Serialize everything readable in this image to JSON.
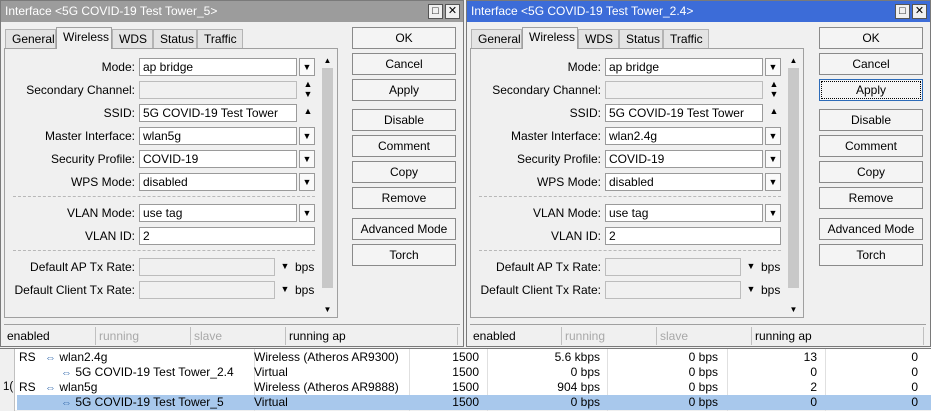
{
  "windows": [
    {
      "title": "Interface <5G COVID-19 Test Tower_5>",
      "tabs": [
        "General",
        "Wireless",
        "WDS",
        "Status",
        "Traffic"
      ],
      "active_tab": "Wireless",
      "fields": {
        "mode": {
          "label": "Mode:",
          "value": "ap bridge"
        },
        "secondary_channel": {
          "label": "Secondary Channel:",
          "value": ""
        },
        "ssid": {
          "label": "SSID:",
          "value": "5G COVID-19 Test Tower"
        },
        "master_interface": {
          "label": "Master Interface:",
          "value": "wlan5g"
        },
        "security_profile": {
          "label": "Security Profile:",
          "value": "COVID-19"
        },
        "wps_mode": {
          "label": "WPS Mode:",
          "value": "disabled"
        },
        "vlan_mode": {
          "label": "VLAN Mode:",
          "value": "use tag"
        },
        "vlan_id": {
          "label": "VLAN ID:",
          "value": "2"
        },
        "default_ap_tx_rate": {
          "label": "Default AP Tx Rate:",
          "value": "",
          "unit": "bps"
        },
        "default_client_tx_rate": {
          "label": "Default Client Tx Rate:",
          "value": "",
          "unit": "bps"
        }
      },
      "buttons": [
        "OK",
        "Cancel",
        "Apply",
        "Disable",
        "Comment",
        "Copy",
        "Remove",
        "Advanced Mode",
        "Torch"
      ],
      "status": [
        "enabled",
        "running",
        "slave",
        "running ap"
      ]
    },
    {
      "title": "Interface <5G COVID-19 Test Tower_2.4>",
      "tabs": [
        "General",
        "Wireless",
        "WDS",
        "Status",
        "Traffic"
      ],
      "active_tab": "Wireless",
      "fields": {
        "mode": {
          "label": "Mode:",
          "value": "ap bridge"
        },
        "secondary_channel": {
          "label": "Secondary Channel:",
          "value": ""
        },
        "ssid": {
          "label": "SSID:",
          "value": "5G COVID-19 Test Tower"
        },
        "master_interface": {
          "label": "Master Interface:",
          "value": "wlan2.4g"
        },
        "security_profile": {
          "label": "Security Profile:",
          "value": "COVID-19"
        },
        "wps_mode": {
          "label": "WPS Mode:",
          "value": "disabled"
        },
        "vlan_mode": {
          "label": "VLAN Mode:",
          "value": "use tag"
        },
        "vlan_id": {
          "label": "VLAN ID:",
          "value": "2"
        },
        "default_ap_tx_rate": {
          "label": "Default AP Tx Rate:",
          "value": "",
          "unit": "bps"
        },
        "default_client_tx_rate": {
          "label": "Default Client Tx Rate:",
          "value": "",
          "unit": "bps"
        }
      },
      "buttons": [
        "OK",
        "Cancel",
        "Apply",
        "Disable",
        "Comment",
        "Copy",
        "Remove",
        "Advanced Mode",
        "Torch"
      ],
      "status": [
        "enabled",
        "running",
        "slave",
        "running ap"
      ]
    }
  ],
  "title_buttons": {
    "maximize": "□",
    "close": "✕"
  },
  "icons": {
    "dropdown": "▼",
    "up": "▲",
    "down": "▼",
    "interface": "⇔"
  },
  "gutter_text": "1(",
  "table_rows": [
    {
      "flags": "RS",
      "name": "wlan2.4g",
      "type": "Wireless (Atheros AR9300)",
      "mtu": "1500",
      "tx": "5.6 kbps",
      "rx": "0 bps",
      "txp": "13",
      "rxp": "0",
      "sub": false,
      "selected": false
    },
    {
      "flags": "",
      "name": "5G COVID-19 Test Tower_2.4",
      "type": "Virtual",
      "mtu": "1500",
      "tx": "0 bps",
      "rx": "0 bps",
      "txp": "0",
      "rxp": "0",
      "sub": true,
      "selected": false
    },
    {
      "flags": "RS",
      "name": "wlan5g",
      "type": "Wireless (Atheros AR9888)",
      "mtu": "1500",
      "tx": "904 bps",
      "rx": "0 bps",
      "txp": "2",
      "rxp": "0",
      "sub": false,
      "selected": false
    },
    {
      "flags": "",
      "name": "5G COVID-19 Test Tower_5",
      "type": "Virtual",
      "mtu": "1500",
      "tx": "0 bps",
      "rx": "0 bps",
      "txp": "0",
      "rxp": "0",
      "sub": true,
      "selected": true
    }
  ],
  "colors": {
    "active_title": "#3c6cd8",
    "inactive_title": "#9c9c9c",
    "selection": "#a8c8ec"
  }
}
